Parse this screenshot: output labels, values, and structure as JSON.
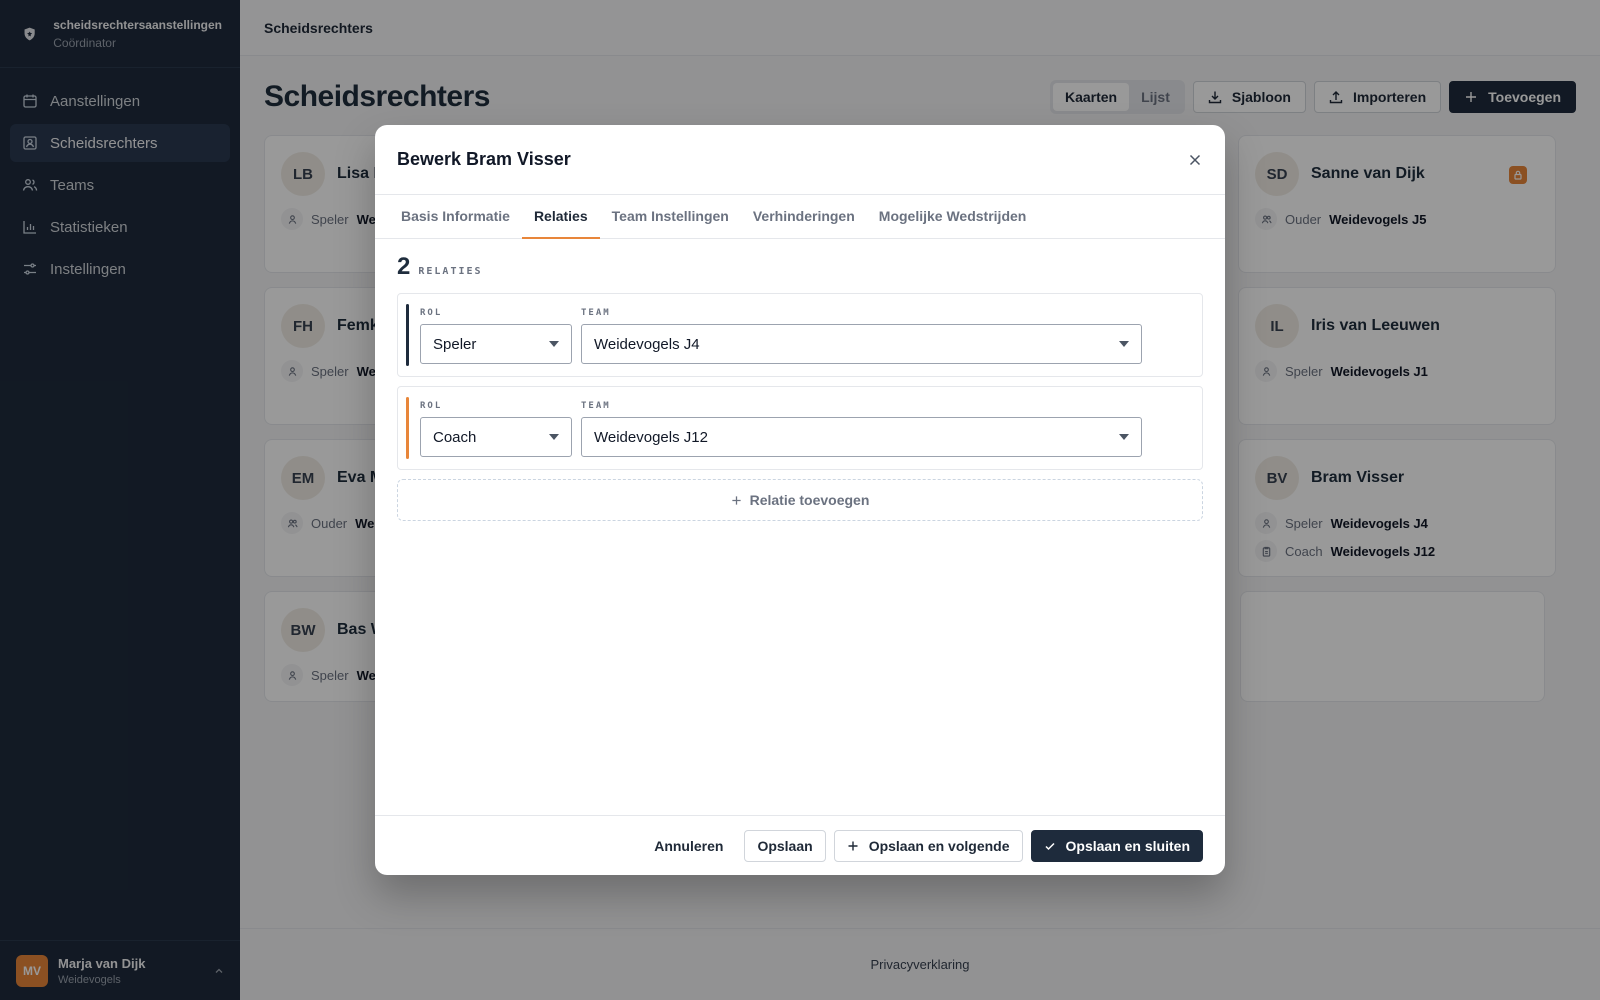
{
  "brand": {
    "name": "scheidsrechtersaanstellingen",
    "role": "Coördinator"
  },
  "nav": [
    {
      "label": "Aanstellingen",
      "icon": "calendar-icon",
      "active": false
    },
    {
      "label": "Scheidsrechters",
      "icon": "id-card-icon",
      "active": true
    },
    {
      "label": "Teams",
      "icon": "users-icon",
      "active": false
    },
    {
      "label": "Statistieken",
      "icon": "bar-chart-icon",
      "active": false
    },
    {
      "label": "Instellingen",
      "icon": "sliders-icon",
      "active": false
    }
  ],
  "user": {
    "initials": "MV",
    "name": "Marja van Dijk",
    "club": "Weidevogels"
  },
  "breadcrumb": "Scheidsrechters",
  "page": {
    "title": "Scheidsrechters",
    "view_cards": "Kaarten",
    "view_list": "Lijst",
    "template_label": "Sjabloon",
    "import_label": "Importeren",
    "add_label": "Toevoegen"
  },
  "cards": [
    {
      "initials": "LB",
      "name": "Lisa B",
      "relations": [
        {
          "role": "Speler",
          "team": "Wei"
        }
      ]
    },
    {
      "initials": "FH",
      "name": "Femk",
      "relations": [
        {
          "role": "Speler",
          "team": "Wei"
        }
      ]
    },
    {
      "initials": "EM",
      "name": "Eva M",
      "relations": [
        {
          "role": "Ouder",
          "team": "Wei"
        }
      ]
    },
    {
      "initials": "BW",
      "name": "Bas W",
      "relations": [
        {
          "role": "Speler",
          "team": "Wei"
        }
      ]
    },
    {
      "initials": "SD",
      "name": "Sanne van Dijk",
      "locked": true,
      "relations": [
        {
          "role": "Ouder",
          "team": "Weidevogels J5"
        }
      ]
    },
    {
      "initials": "IL",
      "name": "Iris van Leeuwen",
      "relations": [
        {
          "role": "Speler",
          "team": "Weidevogels J1"
        }
      ]
    },
    {
      "initials": "BV",
      "name": "Bram Visser",
      "relations": [
        {
          "role": "Speler",
          "team": "Weidevogels J4"
        },
        {
          "role": "Coach",
          "team": "Weidevogels J12"
        }
      ]
    }
  ],
  "footer": {
    "privacy": "Privacyverklaring"
  },
  "modal": {
    "title": "Bewerk Bram Visser",
    "tabs": [
      "Basis Informatie",
      "Relaties",
      "Team Instellingen",
      "Verhinderingen",
      "Mogelijke Wedstrijden"
    ],
    "active_tab": "Relaties",
    "count": "2",
    "count_label": "RELATIES",
    "role_label": "ROL",
    "team_label": "TEAM",
    "relations": [
      {
        "role": "Speler",
        "team": "Weidevogels J4",
        "accent": "#1e2b3c"
      },
      {
        "role": "Coach",
        "team": "Weidevogels J12",
        "accent": "#e8863a"
      }
    ],
    "add_relation": "Relatie toevoegen",
    "cancel": "Annuleren",
    "save": "Opslaan",
    "save_next": "Opslaan en volgende",
    "save_close": "Opslaan en sluiten"
  },
  "colors": {
    "sidebar": "#1e2b3c",
    "accent": "#e8863a",
    "primary": "#1e2b3c"
  }
}
